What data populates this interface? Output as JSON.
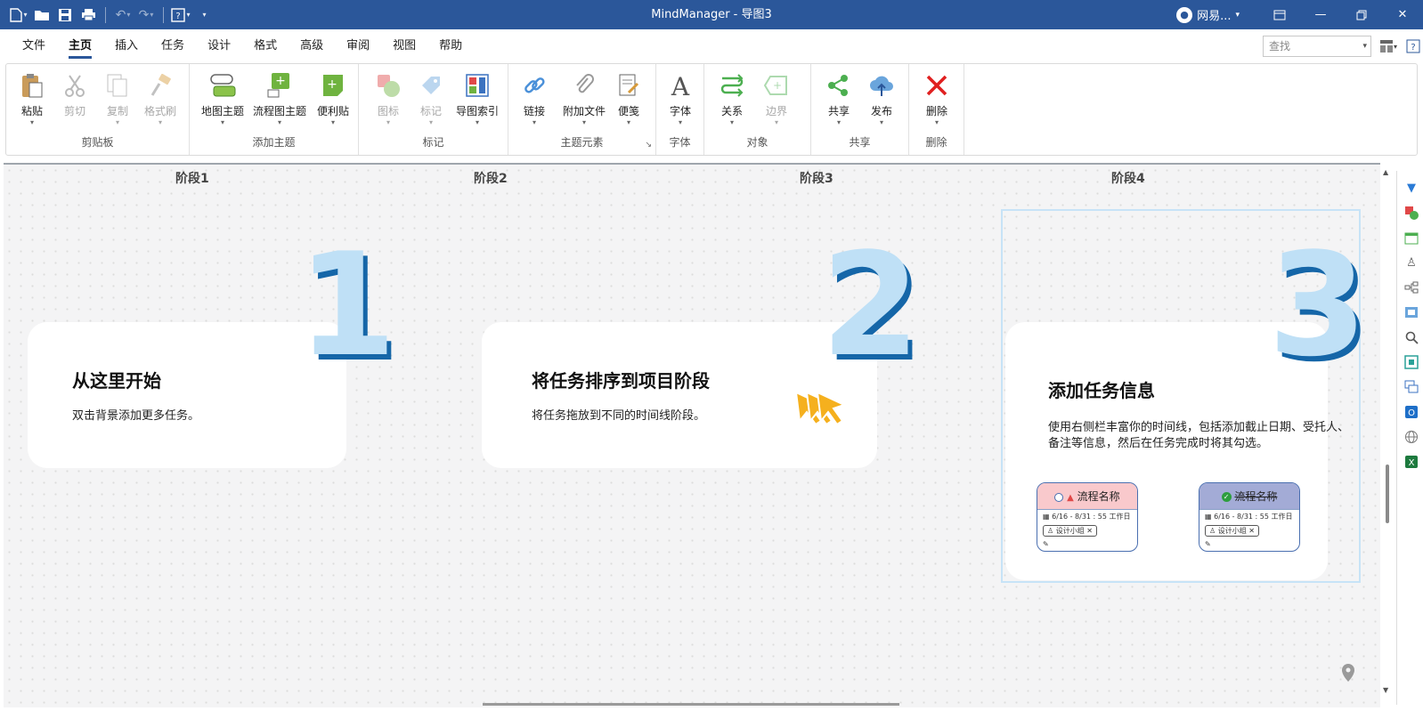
{
  "window": {
    "title": "MindManager - 导图3",
    "account": "网易..."
  },
  "menu": {
    "tabs": [
      "文件",
      "主页",
      "插入",
      "任务",
      "设计",
      "格式",
      "高级",
      "审阅",
      "视图",
      "帮助"
    ],
    "active_index": 1
  },
  "search": {
    "placeholder": "查找"
  },
  "ribbon": {
    "clipboard": {
      "label": "剪贴板",
      "paste": "粘贴",
      "cut": "剪切",
      "copy": "复制",
      "format_painter": "格式刷"
    },
    "add_topic": {
      "label": "添加主题",
      "map_topic": "地图主题",
      "flow_topic": "流程图主题",
      "sticky": "便利贴"
    },
    "markers": {
      "label": "标记",
      "icon": "图标",
      "tag": "标记",
      "map_index": "导图索引"
    },
    "topic_elements": {
      "label": "主题元素",
      "link": "链接",
      "attach": "附加文件",
      "notes": "便笺"
    },
    "font": {
      "label": "字体",
      "font": "字体"
    },
    "objects": {
      "label": "对象",
      "relation": "关系",
      "boundary": "边界"
    },
    "share": {
      "label": "共享",
      "share": "共享",
      "publish": "发布"
    },
    "delete": {
      "label": "删除",
      "delete": "删除"
    }
  },
  "canvas": {
    "phases": [
      "阶段1",
      "阶段2",
      "阶段3",
      "阶段4"
    ],
    "cards": [
      {
        "number": "1",
        "title": "从这里开始",
        "text": "双击背景添加更多任务。"
      },
      {
        "number": "2",
        "title": "将任务排序到项目阶段",
        "text": "将任务拖放到不同的时间线阶段。"
      },
      {
        "number": "3",
        "title": "添加任务信息",
        "text": "使用右侧栏丰富你的时间线，包括添加截止日期、受托人、备注等信息，然后在任务完成时将其勾选。"
      }
    ],
    "mini_cards": [
      {
        "name": "流程名称",
        "date": "6/16 - 8/31 : 55 工作日",
        "assignee": "设计小组",
        "head_color": "#f9c9cc",
        "done": false
      },
      {
        "name": "流程名称",
        "date": "6/16 - 8/31 : 55 工作日",
        "assignee": "设计小组",
        "head_color": "#a3abd6",
        "done": true
      }
    ]
  }
}
